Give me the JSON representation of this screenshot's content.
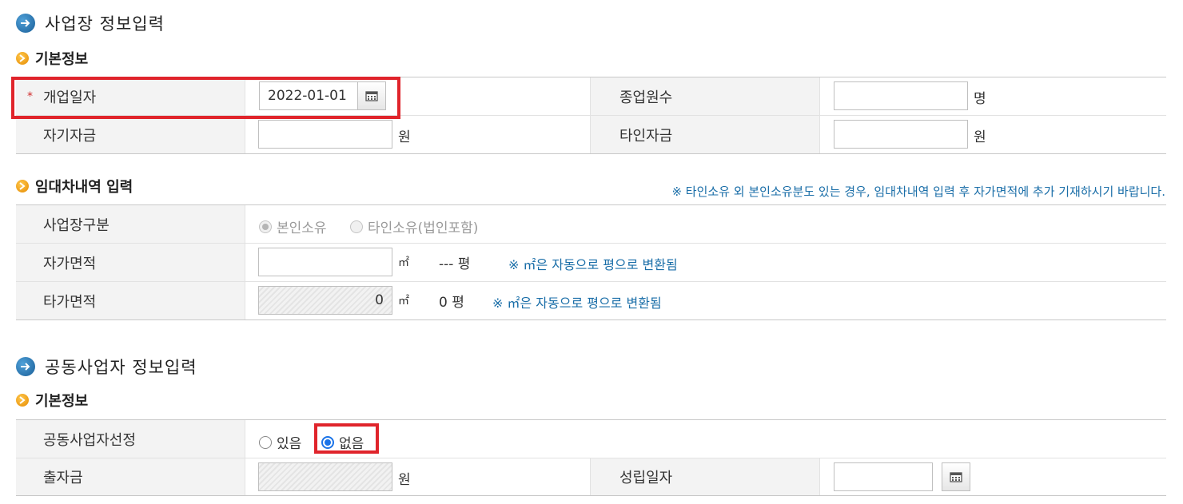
{
  "sections": {
    "business": {
      "title": "사업장 정보입력"
    },
    "joint": {
      "title": "공동사업자 정보입력"
    }
  },
  "basic_info": {
    "subtitle": "기본정보",
    "required_mark": "*",
    "opening_date_label": "개업일자",
    "opening_date_value": "2022-01-01",
    "employees_label": "종업원수",
    "employees_value": "",
    "employees_unit": "명",
    "own_capital_label": "자기자금",
    "own_capital_value": "",
    "own_capital_unit": "원",
    "other_capital_label": "타인자금",
    "other_capital_value": "",
    "other_capital_unit": "원"
  },
  "lease": {
    "subtitle": "임대차내역 입력",
    "notice": "※ 타인소유 외 본인소유분도 있는 경우, 임대차내역 입력 후 자가면적에 추가 기재하시기 바랍니다.",
    "type_label": "사업장구분",
    "type_options": [
      "본인소유",
      "타인소유(법인포함)"
    ],
    "type_selected": "본인소유",
    "own_area_label": "자가면적",
    "own_area_value": "",
    "area_unit": "㎡",
    "own_area_pyeong": "--- 평",
    "own_area_note": "※ ㎡은 자동으로 평으로 변환됨",
    "other_area_label": "타가면적",
    "other_area_value": "0",
    "other_area_pyeong": "0 평",
    "other_area_note": "※ ㎡은 자동으로 평으로 변환됨"
  },
  "joint_basic": {
    "subtitle": "기본정보",
    "select_label": "공동사업자선정",
    "options": [
      "있음",
      "없음"
    ],
    "selected": "없음",
    "investment_label": "출자금",
    "investment_value": "",
    "investment_unit": "원",
    "established_label": "성립일자",
    "established_value": ""
  }
}
